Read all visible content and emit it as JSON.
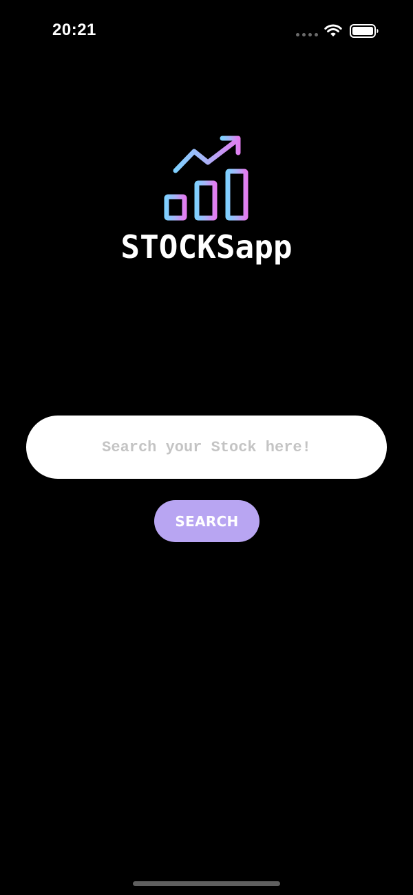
{
  "status_bar": {
    "time": "20:21",
    "icons": [
      "signal-dots-icon",
      "wifi-icon",
      "battery-icon"
    ]
  },
  "app": {
    "logo_icon": "rising-bar-chart-icon",
    "title": "STOCKSapp"
  },
  "search": {
    "value": "",
    "placeholder": "Search your Stock here!",
    "button_label": "SEARCH"
  },
  "colors": {
    "background": "#000000",
    "button": "#b8a5f2",
    "logo_gradient_start": "#7fd0ff",
    "logo_gradient_mid": "#a9b2f7",
    "logo_gradient_end": "#e27df0"
  }
}
